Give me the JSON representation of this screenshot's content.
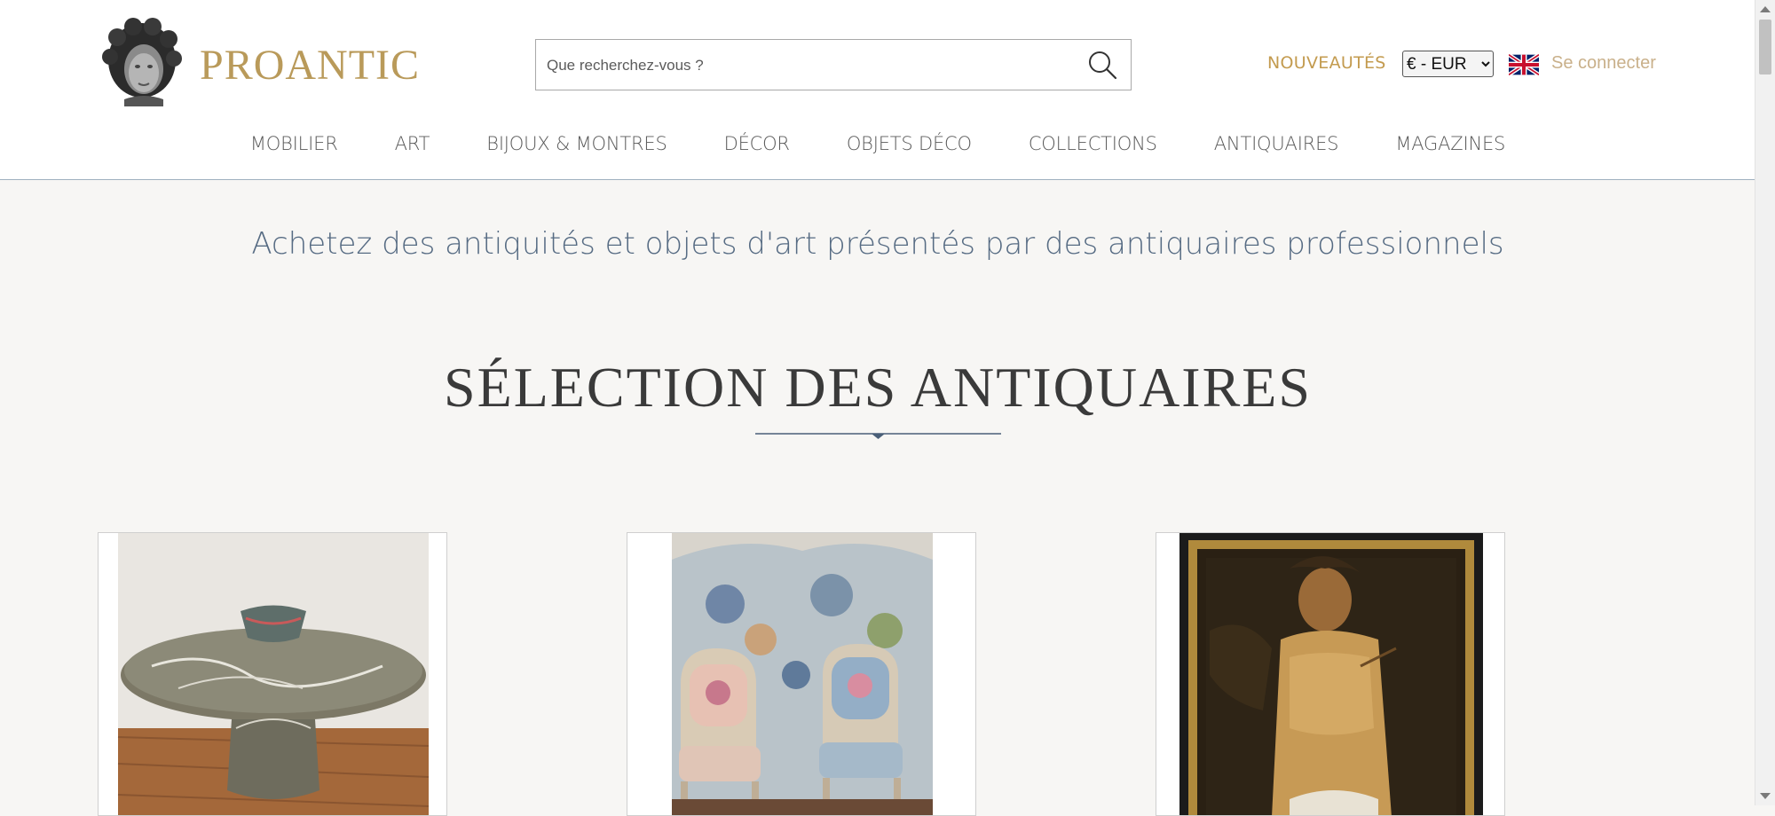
{
  "brand": {
    "name": "PROANTIC"
  },
  "search": {
    "placeholder": "Que recherchez-vous ?"
  },
  "header": {
    "new_label": "NOUVEAUTÉS",
    "currency_selected": "€ - EUR",
    "login_label": "Se connecter"
  },
  "nav": {
    "items": [
      {
        "label": "MOBILIER"
      },
      {
        "label": "ART"
      },
      {
        "label": "BIJOUX & MONTRES"
      },
      {
        "label": "DÉCOR"
      },
      {
        "label": "OBJETS DÉCO"
      },
      {
        "label": "COLLECTIONS"
      },
      {
        "label": "ANTIQUAIRES"
      },
      {
        "label": "MAGAZINES"
      }
    ]
  },
  "hero": {
    "tagline": "Achetez des antiquités et objets d'art présentés par des antiquaires professionnels",
    "section_title": "SÉLECTION DES ANTIQUAIRES"
  },
  "icons": [
    "search-icon",
    "uk-flag-icon",
    "logo-bust-icon"
  ],
  "colors": {
    "brand_gold": "#b99a5a",
    "nav_text": "#5a5a5a",
    "tagline": "#566b83",
    "accent_blue": "#4a5f78"
  }
}
